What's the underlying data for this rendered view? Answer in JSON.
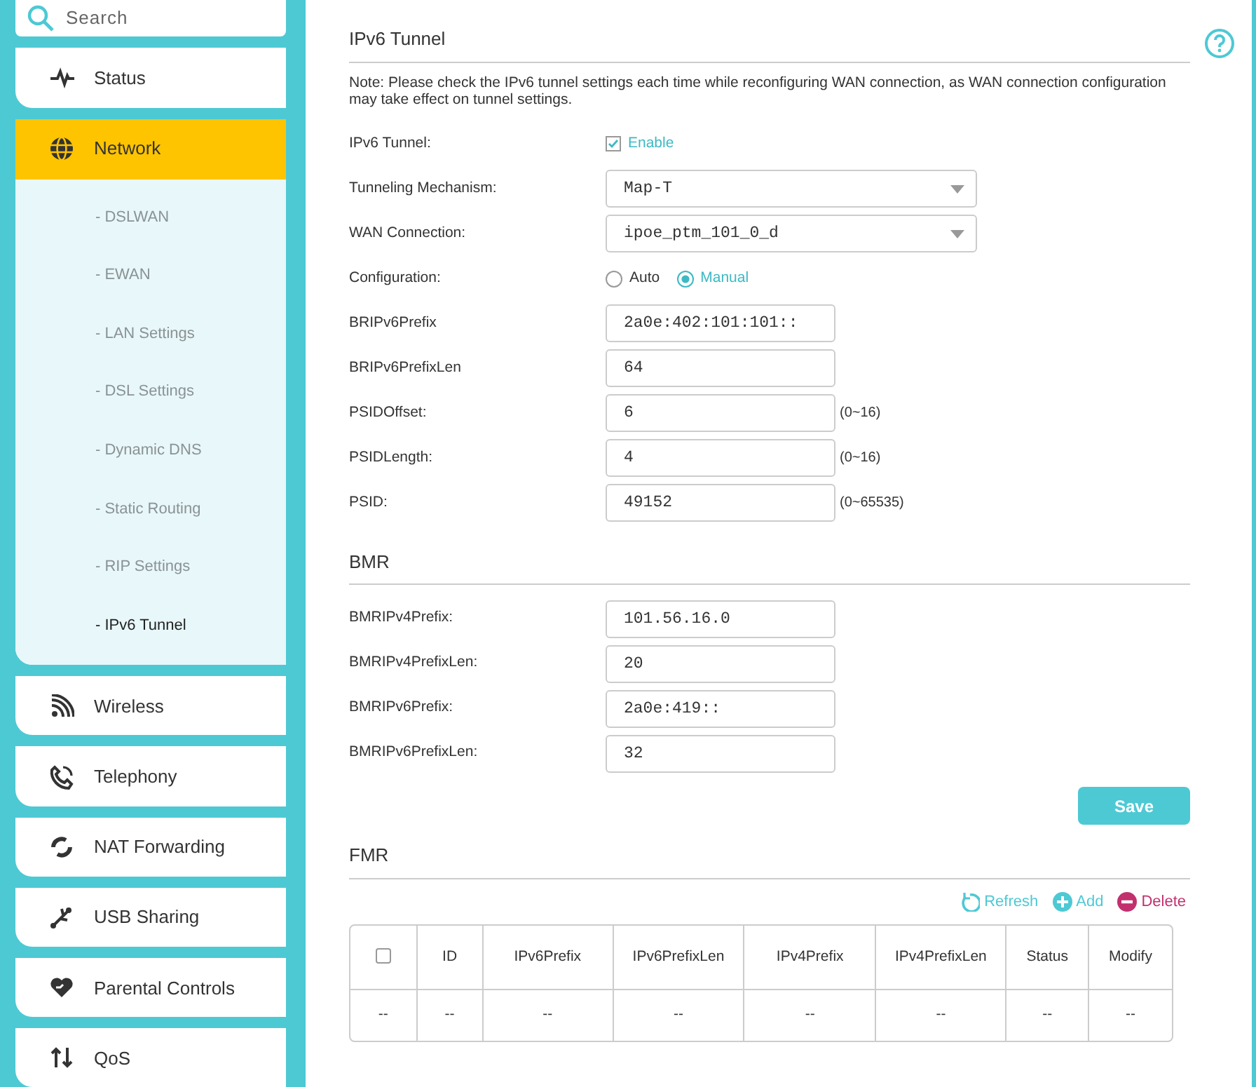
{
  "search": {
    "placeholder": "Search"
  },
  "sidebar": {
    "items": [
      {
        "label": "Status",
        "selected": false
      },
      {
        "label": "Network",
        "selected": true,
        "children": [
          {
            "label": "- DSLWAN",
            "selected": false
          },
          {
            "label": "- EWAN",
            "selected": false
          },
          {
            "label": "- LAN Settings",
            "selected": false
          },
          {
            "label": "- DSL Settings",
            "selected": false
          },
          {
            "label": "- Dynamic DNS",
            "selected": false
          },
          {
            "label": "- Static Routing",
            "selected": false
          },
          {
            "label": "- RIP Settings",
            "selected": false
          },
          {
            "label": "- IPv6 Tunnel",
            "selected": true
          }
        ]
      },
      {
        "label": "Wireless",
        "selected": false
      },
      {
        "label": "Telephony",
        "selected": false
      },
      {
        "label": "NAT Forwarding",
        "selected": false
      },
      {
        "label": "USB Sharing",
        "selected": false
      },
      {
        "label": "Parental Controls",
        "selected": false
      },
      {
        "label": "QoS",
        "selected": false
      }
    ]
  },
  "tunnel": {
    "title": "IPv6 Tunnel",
    "note": "Note: Please check the IPv6 tunnel settings each time while reconfiguring WAN connection, as WAN connection configuration may take effect on tunnel settings.",
    "fields": [
      {
        "kind": "checkbox",
        "label": "IPv6 Tunnel:",
        "option": "Enable",
        "checked": true
      },
      {
        "kind": "select",
        "label": "Tunneling Mechanism:",
        "value": "Map-T"
      },
      {
        "kind": "select",
        "label": "WAN Connection:",
        "value": "ipoe_ptm_101_0_d"
      },
      {
        "kind": "radio",
        "label": "Configuration:",
        "options": [
          {
            "label": "Auto",
            "selected": false
          },
          {
            "label": "Manual",
            "selected": true
          }
        ]
      },
      {
        "kind": "text",
        "label": "BRIPv6Prefix",
        "value": "2a0e:402:101:101::"
      },
      {
        "kind": "text",
        "label": "BRIPv6PrefixLen",
        "value": "64"
      },
      {
        "kind": "text",
        "label": "PSIDOffset:",
        "value": "6",
        "hint": "(0~16)"
      },
      {
        "kind": "text",
        "label": "PSIDLength:",
        "value": "4",
        "hint": "(0~16)"
      },
      {
        "kind": "text",
        "label": "PSID:",
        "value": "49152",
        "hint": "(0~65535)"
      }
    ]
  },
  "bmr": {
    "title": "BMR",
    "fields": [
      {
        "kind": "text",
        "label": "BMRIPv4Prefix:",
        "value": "101.56.16.0"
      },
      {
        "kind": "text",
        "label": "BMRIPv4PrefixLen:",
        "value": "20"
      },
      {
        "kind": "text",
        "label": "BMRIPv6Prefix:",
        "value": "2a0e:419::"
      },
      {
        "kind": "text",
        "label": "BMRIPv6PrefixLen:",
        "value": "32"
      }
    ],
    "save": "Save"
  },
  "fmr": {
    "title": "FMR",
    "actions": [
      {
        "kind": "refresh",
        "label": "Refresh"
      },
      {
        "kind": "add",
        "label": "Add"
      },
      {
        "kind": "delete",
        "label": "Delete"
      }
    ],
    "table": {
      "select_all_checked": false,
      "columns": [
        "",
        "ID",
        "IPv6Prefix",
        "IPv6PrefixLen",
        "IPv4Prefix",
        "IPv4PrefixLen",
        "Status",
        "Modify"
      ],
      "rows": [
        [
          "--",
          "--",
          "--",
          "--",
          "--",
          "--",
          "--",
          "--"
        ]
      ]
    }
  }
}
